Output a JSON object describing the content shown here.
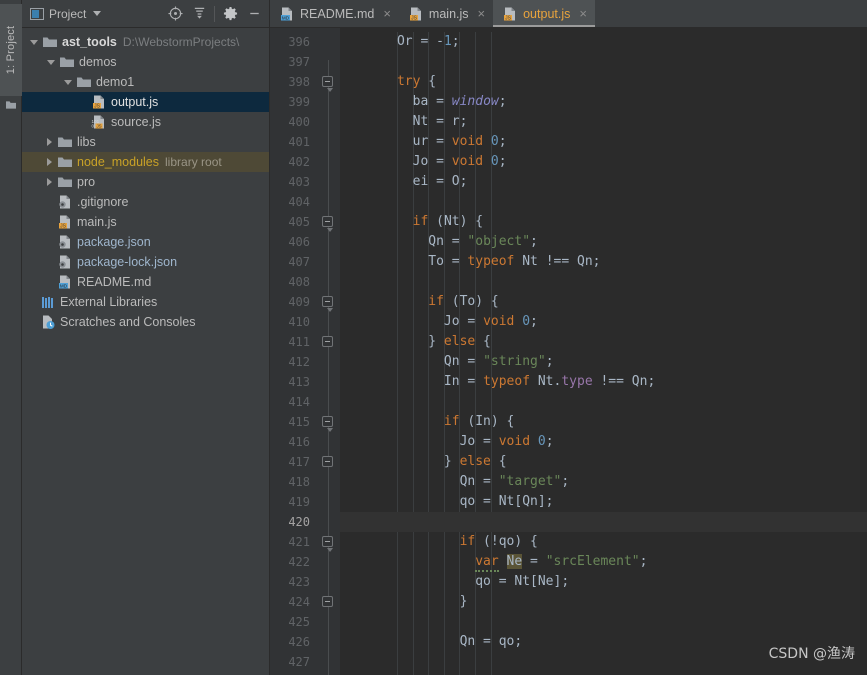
{
  "toolwindow": {
    "vertical_tab_label": "1: Project",
    "vertical_tab_icon": "folder-icon",
    "title": "Project",
    "title_icon": "project-window-icon",
    "buttons": [
      {
        "name": "locate-file-button",
        "icon": "crosshair-target-icon",
        "label": ""
      },
      {
        "name": "collapse-all-button",
        "icon": "collapse-all-icon",
        "label": ""
      },
      {
        "name": "settings-button",
        "icon": "gear-icon",
        "label": ""
      },
      {
        "name": "hide-button",
        "icon": "minimize-icon",
        "label": ""
      }
    ]
  },
  "tree": [
    {
      "name": "ast_tools",
      "suffix": "D:\\WebstormProjects\\",
      "indent": 0,
      "arrow": "open",
      "icon": "folder-icon",
      "style": "bold",
      "selected": false
    },
    {
      "name": "demos",
      "suffix": "",
      "indent": 1,
      "arrow": "open",
      "icon": "folder-icon",
      "style": "plain",
      "selected": false
    },
    {
      "name": "demo1",
      "suffix": "",
      "indent": 2,
      "arrow": "open",
      "icon": "folder-icon",
      "style": "plain",
      "selected": false
    },
    {
      "name": "output.js",
      "suffix": "",
      "indent": 3,
      "arrow": "none",
      "icon": "js-file-icon",
      "style": "sel",
      "selected": true
    },
    {
      "name": "source.js",
      "suffix": "",
      "indent": 3,
      "arrow": "none",
      "icon": "js-binary-file-icon",
      "style": "plain",
      "selected": false
    },
    {
      "name": "libs",
      "suffix": "",
      "indent": 1,
      "arrow": "closed",
      "icon": "folder-icon",
      "style": "plain",
      "selected": false
    },
    {
      "name": "node_modules",
      "suffix": "library root",
      "indent": 1,
      "arrow": "closed",
      "icon": "folder-icon",
      "style": "nm",
      "selected": false
    },
    {
      "name": "pro",
      "suffix": "",
      "indent": 1,
      "arrow": "closed",
      "icon": "folder-icon",
      "style": "plain",
      "selected": false
    },
    {
      "name": ".gitignore",
      "suffix": "",
      "indent": 1,
      "arrow": "none",
      "icon": "gitignore-file-icon",
      "style": "plain",
      "selected": false
    },
    {
      "name": "main.js",
      "suffix": "",
      "indent": 1,
      "arrow": "none",
      "icon": "js-file-icon",
      "style": "plain",
      "selected": false
    },
    {
      "name": "package.json",
      "suffix": "",
      "indent": 1,
      "arrow": "none",
      "icon": "json-file-icon",
      "style": "json",
      "selected": false
    },
    {
      "name": "package-lock.json",
      "suffix": "",
      "indent": 1,
      "arrow": "none",
      "icon": "json-file-icon",
      "style": "json",
      "selected": false
    },
    {
      "name": "README.md",
      "suffix": "",
      "indent": 1,
      "arrow": "none",
      "icon": "md-file-icon",
      "style": "plain",
      "selected": false
    },
    {
      "name": "External Libraries",
      "suffix": "",
      "indent": 0,
      "arrow": "none",
      "icon": "libraries-icon",
      "style": "plain",
      "selected": false
    },
    {
      "name": "Scratches and Consoles",
      "suffix": "",
      "indent": 0,
      "arrow": "none",
      "icon": "scratches-icon",
      "style": "plain",
      "selected": false
    }
  ],
  "tabs": [
    {
      "label": "README.md",
      "icon": "md-file-icon",
      "active": false,
      "close": "×"
    },
    {
      "label": "main.js",
      "icon": "js-file-icon",
      "active": false,
      "close": "×"
    },
    {
      "label": "output.js",
      "icon": "js-file-icon",
      "active": true,
      "close": "×"
    }
  ],
  "editor": {
    "first_line": 396,
    "caret_line": 420,
    "lines": [
      {
        "n": 396,
        "fold": "none",
        "tokens": [
          {
            "t": "      ",
            "c": "op"
          },
          {
            "t": "Or",
            "c": "id"
          },
          {
            "t": " = ",
            "c": "op"
          },
          {
            "t": "-",
            "c": "op"
          },
          {
            "t": "1",
            "c": "num"
          },
          {
            "t": ";",
            "c": "op"
          }
        ]
      },
      {
        "n": 397,
        "fold": "none",
        "tokens": []
      },
      {
        "n": 398,
        "fold": "open",
        "tokens": [
          {
            "t": "      ",
            "c": "op"
          },
          {
            "t": "try",
            "c": "kw"
          },
          {
            "t": " {",
            "c": "op"
          }
        ]
      },
      {
        "n": 399,
        "fold": "none",
        "tokens": [
          {
            "t": "        ",
            "c": "op"
          },
          {
            "t": "ba",
            "c": "id"
          },
          {
            "t": " = ",
            "c": "op"
          },
          {
            "t": "window",
            "c": "glob"
          },
          {
            "t": ";",
            "c": "op"
          }
        ]
      },
      {
        "n": 400,
        "fold": "none",
        "tokens": [
          {
            "t": "        ",
            "c": "op"
          },
          {
            "t": "Nt",
            "c": "id"
          },
          {
            "t": " = ",
            "c": "op"
          },
          {
            "t": "r",
            "c": "id"
          },
          {
            "t": ";",
            "c": "op"
          }
        ]
      },
      {
        "n": 401,
        "fold": "none",
        "tokens": [
          {
            "t": "        ",
            "c": "op"
          },
          {
            "t": "ur",
            "c": "id"
          },
          {
            "t": " = ",
            "c": "op"
          },
          {
            "t": "void",
            "c": "kw"
          },
          {
            "t": " ",
            "c": "op"
          },
          {
            "t": "0",
            "c": "num"
          },
          {
            "t": ";",
            "c": "op"
          }
        ]
      },
      {
        "n": 402,
        "fold": "none",
        "tokens": [
          {
            "t": "        ",
            "c": "op"
          },
          {
            "t": "Jo",
            "c": "id"
          },
          {
            "t": " = ",
            "c": "op"
          },
          {
            "t": "void",
            "c": "kw"
          },
          {
            "t": " ",
            "c": "op"
          },
          {
            "t": "0",
            "c": "num"
          },
          {
            "t": ";",
            "c": "op"
          }
        ]
      },
      {
        "n": 403,
        "fold": "none",
        "tokens": [
          {
            "t": "        ",
            "c": "op"
          },
          {
            "t": "ei",
            "c": "id"
          },
          {
            "t": " = ",
            "c": "op"
          },
          {
            "t": "O",
            "c": "id"
          },
          {
            "t": ";",
            "c": "op"
          }
        ]
      },
      {
        "n": 404,
        "fold": "none",
        "tokens": []
      },
      {
        "n": 405,
        "fold": "open",
        "tokens": [
          {
            "t": "        ",
            "c": "op"
          },
          {
            "t": "if",
            "c": "kw"
          },
          {
            "t": " (",
            "c": "op"
          },
          {
            "t": "Nt",
            "c": "id"
          },
          {
            "t": ") {",
            "c": "op"
          }
        ]
      },
      {
        "n": 406,
        "fold": "none",
        "tokens": [
          {
            "t": "          ",
            "c": "op"
          },
          {
            "t": "Qn",
            "c": "id"
          },
          {
            "t": " = ",
            "c": "op"
          },
          {
            "t": "\"object\"",
            "c": "str"
          },
          {
            "t": ";",
            "c": "op"
          }
        ]
      },
      {
        "n": 407,
        "fold": "none",
        "tokens": [
          {
            "t": "          ",
            "c": "op"
          },
          {
            "t": "To",
            "c": "id"
          },
          {
            "t": " = ",
            "c": "op"
          },
          {
            "t": "typeof",
            "c": "kw"
          },
          {
            "t": " ",
            "c": "op"
          },
          {
            "t": "Nt",
            "c": "id"
          },
          {
            "t": " !== ",
            "c": "op"
          },
          {
            "t": "Qn",
            "c": "id"
          },
          {
            "t": ";",
            "c": "op"
          }
        ]
      },
      {
        "n": 408,
        "fold": "none",
        "tokens": []
      },
      {
        "n": 409,
        "fold": "open",
        "tokens": [
          {
            "t": "          ",
            "c": "op"
          },
          {
            "t": "if",
            "c": "kw"
          },
          {
            "t": " (",
            "c": "op"
          },
          {
            "t": "To",
            "c": "id"
          },
          {
            "t": ") {",
            "c": "op"
          }
        ]
      },
      {
        "n": 410,
        "fold": "none",
        "tokens": [
          {
            "t": "            ",
            "c": "op"
          },
          {
            "t": "Jo",
            "c": "id"
          },
          {
            "t": " = ",
            "c": "op"
          },
          {
            "t": "void",
            "c": "kw"
          },
          {
            "t": " ",
            "c": "op"
          },
          {
            "t": "0",
            "c": "num"
          },
          {
            "t": ";",
            "c": "op"
          }
        ]
      },
      {
        "n": 411,
        "fold": "close",
        "tokens": [
          {
            "t": "          } ",
            "c": "op"
          },
          {
            "t": "else",
            "c": "kw"
          },
          {
            "t": " {",
            "c": "op"
          }
        ]
      },
      {
        "n": 412,
        "fold": "none",
        "tokens": [
          {
            "t": "            ",
            "c": "op"
          },
          {
            "t": "Qn",
            "c": "id"
          },
          {
            "t": " = ",
            "c": "op"
          },
          {
            "t": "\"string\"",
            "c": "str"
          },
          {
            "t": ";",
            "c": "op"
          }
        ]
      },
      {
        "n": 413,
        "fold": "none",
        "tokens": [
          {
            "t": "            ",
            "c": "op"
          },
          {
            "t": "In",
            "c": "id"
          },
          {
            "t": " = ",
            "c": "op"
          },
          {
            "t": "typeof",
            "c": "kw"
          },
          {
            "t": " ",
            "c": "op"
          },
          {
            "t": "Nt",
            "c": "id"
          },
          {
            "t": ".",
            "c": "op"
          },
          {
            "t": "type",
            "c": "prop"
          },
          {
            "t": " !== ",
            "c": "op"
          },
          {
            "t": "Qn",
            "c": "id"
          },
          {
            "t": ";",
            "c": "op"
          }
        ]
      },
      {
        "n": 414,
        "fold": "none",
        "tokens": []
      },
      {
        "n": 415,
        "fold": "open",
        "tokens": [
          {
            "t": "            ",
            "c": "op"
          },
          {
            "t": "if",
            "c": "kw"
          },
          {
            "t": " (",
            "c": "op"
          },
          {
            "t": "In",
            "c": "id"
          },
          {
            "t": ") {",
            "c": "op"
          }
        ]
      },
      {
        "n": 416,
        "fold": "none",
        "tokens": [
          {
            "t": "              ",
            "c": "op"
          },
          {
            "t": "Jo",
            "c": "id"
          },
          {
            "t": " = ",
            "c": "op"
          },
          {
            "t": "void",
            "c": "kw"
          },
          {
            "t": " ",
            "c": "op"
          },
          {
            "t": "0",
            "c": "num"
          },
          {
            "t": ";",
            "c": "op"
          }
        ]
      },
      {
        "n": 417,
        "fold": "close",
        "tokens": [
          {
            "t": "            } ",
            "c": "op"
          },
          {
            "t": "else",
            "c": "kw"
          },
          {
            "t": " {",
            "c": "op"
          }
        ]
      },
      {
        "n": 418,
        "fold": "none",
        "tokens": [
          {
            "t": "              ",
            "c": "op"
          },
          {
            "t": "Qn",
            "c": "id"
          },
          {
            "t": " = ",
            "c": "op"
          },
          {
            "t": "\"target\"",
            "c": "str"
          },
          {
            "t": ";",
            "c": "op"
          }
        ]
      },
      {
        "n": 419,
        "fold": "none",
        "tokens": [
          {
            "t": "              ",
            "c": "op"
          },
          {
            "t": "qo",
            "c": "id"
          },
          {
            "t": " = ",
            "c": "op"
          },
          {
            "t": "Nt",
            "c": "id"
          },
          {
            "t": "[",
            "c": "op"
          },
          {
            "t": "Qn",
            "c": "id"
          },
          {
            "t": "];",
            "c": "op"
          }
        ]
      },
      {
        "n": 420,
        "fold": "none",
        "tokens": []
      },
      {
        "n": 421,
        "fold": "open",
        "tokens": [
          {
            "t": "              ",
            "c": "op"
          },
          {
            "t": "if",
            "c": "kw"
          },
          {
            "t": " (!",
            "c": "op"
          },
          {
            "t": "qo",
            "c": "id"
          },
          {
            "t": ") {",
            "c": "op"
          }
        ]
      },
      {
        "n": 422,
        "fold": "none",
        "tokens": [
          {
            "t": "                ",
            "c": "op"
          },
          {
            "t": "var",
            "c": "kw warn"
          },
          {
            "t": " ",
            "c": "op"
          },
          {
            "t": "Ne",
            "c": "id hl"
          },
          {
            "t": " = ",
            "c": "op"
          },
          {
            "t": "\"srcElement\"",
            "c": "str"
          },
          {
            "t": ";",
            "c": "op"
          }
        ]
      },
      {
        "n": 423,
        "fold": "none",
        "tokens": [
          {
            "t": "                ",
            "c": "op"
          },
          {
            "t": "qo",
            "c": "id"
          },
          {
            "t": " = ",
            "c": "op"
          },
          {
            "t": "Nt",
            "c": "id"
          },
          {
            "t": "[",
            "c": "op"
          },
          {
            "t": "Ne",
            "c": "id"
          },
          {
            "t": "];",
            "c": "op"
          }
        ]
      },
      {
        "n": 424,
        "fold": "close",
        "tokens": [
          {
            "t": "              }",
            "c": "op"
          }
        ]
      },
      {
        "n": 425,
        "fold": "none",
        "tokens": []
      },
      {
        "n": 426,
        "fold": "none",
        "tokens": [
          {
            "t": "              ",
            "c": "op"
          },
          {
            "t": "Qn",
            "c": "id"
          },
          {
            "t": " = ",
            "c": "op"
          },
          {
            "t": "qo",
            "c": "id"
          },
          {
            "t": ";",
            "c": "op"
          }
        ]
      },
      {
        "n": 427,
        "fold": "none",
        "tokens": []
      }
    ]
  },
  "watermark": "CSDN @渔涛",
  "colors": {
    "panel_bg": "#3c3f41",
    "editor_bg": "#2b2b2b",
    "gutter_bg": "#313335",
    "selection": "#0d293e",
    "library_root": "#4e4936",
    "active_tab_text": "#e8a33d",
    "keyword": "#cc7832",
    "string": "#6a8759",
    "number": "#6897bb",
    "identifier": "#a9b7c6",
    "property": "#9876aa",
    "global": "#8888c6",
    "highlight": "#5a5436"
  }
}
